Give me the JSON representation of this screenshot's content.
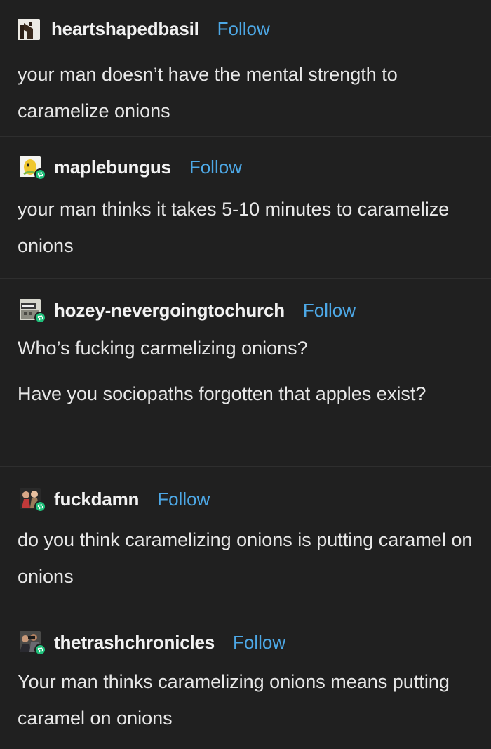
{
  "posts": [
    {
      "username": "heartshapedbasil",
      "follow_label": "Follow",
      "paragraphs": [
        "your man doesn’t have the mental strength to caramelize onions"
      ],
      "avatar_icon": "house-photo-avatar",
      "has_reblog_badge": false
    },
    {
      "username": "maplebungus",
      "follow_label": "Follow",
      "paragraphs": [
        "your man thinks it takes 5-10 minutes to caramelize onions"
      ],
      "avatar_icon": "yellow-character-avatar",
      "has_reblog_badge": true
    },
    {
      "username": "hozey-nevergoingtochurch",
      "follow_label": "Follow",
      "paragraphs": [
        "Who’s fucking carmelizing onions?",
        "Have you sociopaths forgotten that apples exist?"
      ],
      "avatar_icon": "building-avatar",
      "has_reblog_badge": true
    },
    {
      "username": "fuckdamn",
      "follow_label": "Follow",
      "paragraphs": [
        "do you think caramelizing onions is putting caramel on onions"
      ],
      "avatar_icon": "figures-avatar",
      "has_reblog_badge": true
    },
    {
      "username": "thetrashchronicles",
      "follow_label": "Follow",
      "paragraphs": [
        "Your man thinks caramelizing onions means putting caramel on onions"
      ],
      "avatar_icon": "group-photo-avatar",
      "has_reblog_badge": true
    }
  ],
  "colors": {
    "background": "#202020",
    "text": "#e8e8e8",
    "follow_link": "#4da8e6",
    "reblog_badge": "#1fc07a",
    "divider": "#2e2e2e"
  }
}
